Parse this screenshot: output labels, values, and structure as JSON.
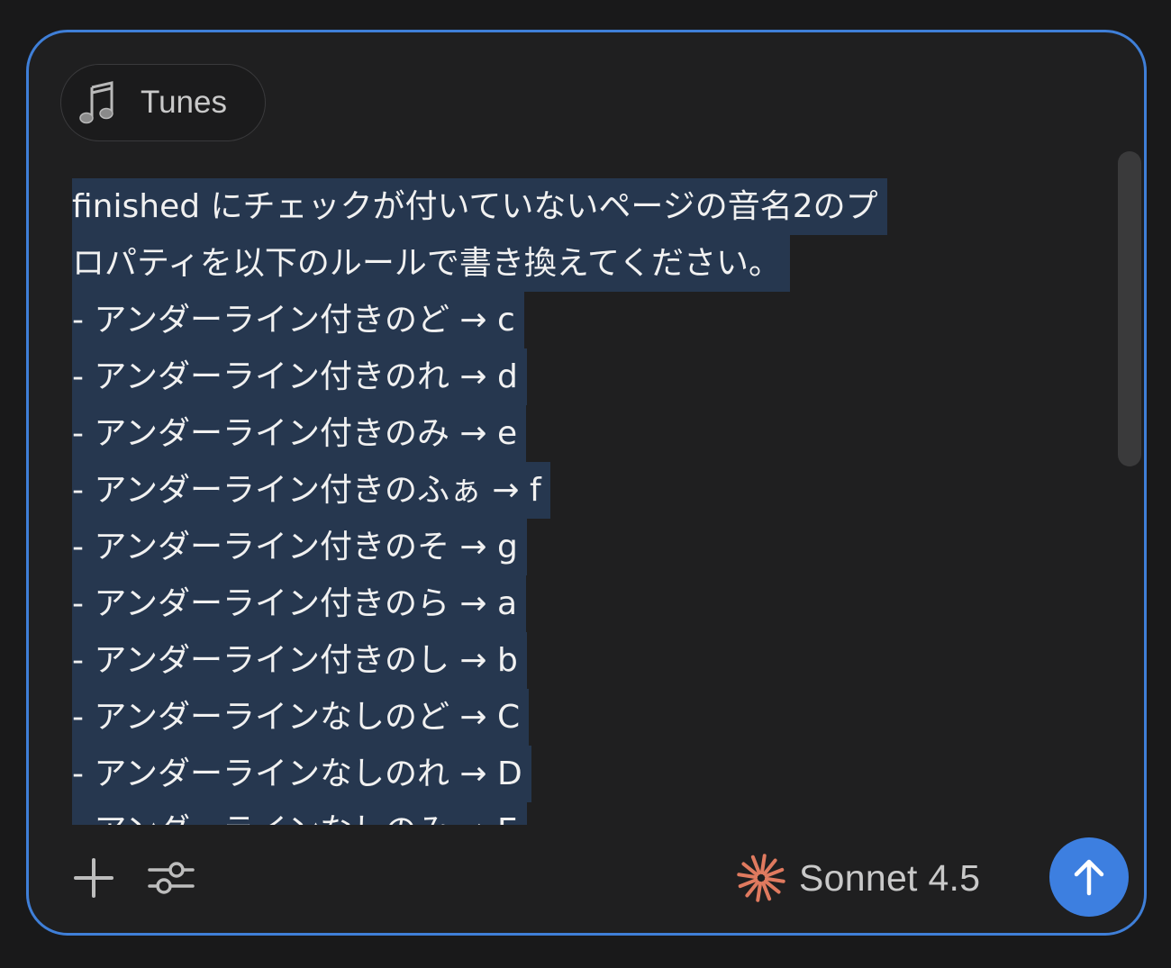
{
  "chip": {
    "icon": "music-note-icon",
    "label": "Tunes"
  },
  "prompt": {
    "lines": [
      "finished にチェックが付いていないページの音名2のプ",
      "ロパティを以下のルールで書き換えてください。",
      "- アンダーライン付きのど → c",
      "- アンダーライン付きのれ → d",
      "- アンダーライン付きのみ → e",
      "- アンダーライン付きのふぁ → f",
      "- アンダーライン付きのそ → g",
      "- アンダーライン付きのら → a",
      "- アンダーライン付きのし → b",
      "- アンダーラインなしのど → C",
      "- アンダーラインなしのれ → D",
      "- アンダーラインなしのみ → E"
    ]
  },
  "toolbar": {
    "add_icon": "plus-icon",
    "settings_icon": "sliders-icon"
  },
  "model": {
    "icon": "sparkle-icon",
    "label": "Sonnet 4.5",
    "icon_color": "#e07a5f"
  },
  "send": {
    "icon": "arrow-up-icon",
    "color": "#3d7fe0"
  },
  "colors": {
    "focus_border": "#3f7fd8",
    "selection": "#26374f"
  }
}
